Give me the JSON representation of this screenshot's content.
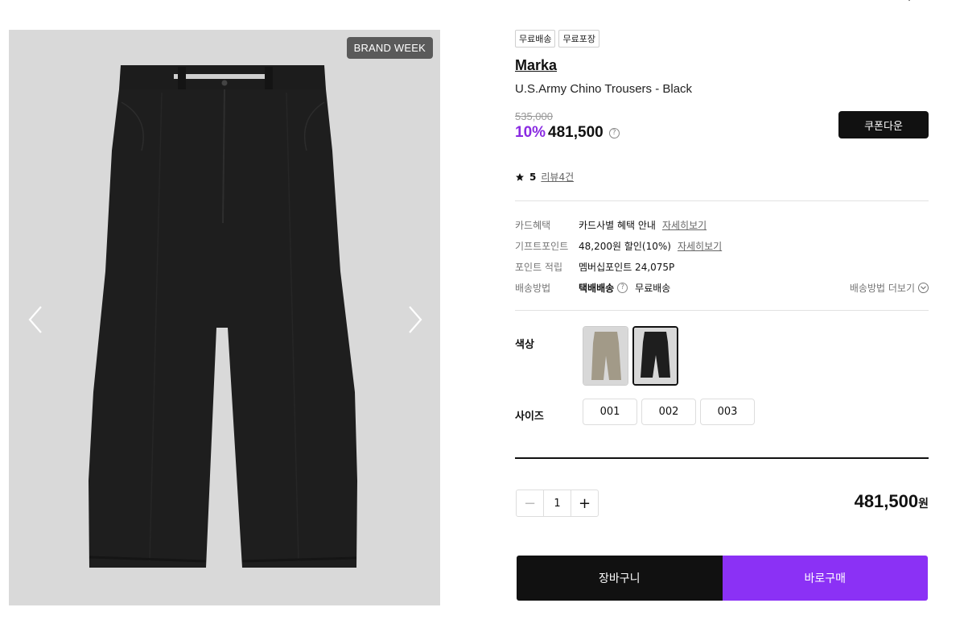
{
  "gallery": {
    "badge": "BRAND WEEK"
  },
  "product": {
    "tags": [
      "무료배송",
      "무료포장"
    ],
    "brand": "Marka",
    "name": "U.S.Army Chino Trousers - Black",
    "original_price": "535,000",
    "discount": "10%",
    "sale_price": "481,500",
    "coupon_button": "쿠폰다운"
  },
  "rating": {
    "score": "5",
    "reviews_link": "리뷰4건"
  },
  "benefits": [
    {
      "label": "카드혜택",
      "value": "카드사별 혜택 안내",
      "link": "자세히보기"
    },
    {
      "label": "기프트포인트",
      "value": "48,200원 할인(10%)",
      "link": "자세히보기"
    },
    {
      "label": "포인트 적립",
      "value": "멤버십포인트 24,075P",
      "link": ""
    },
    {
      "label": "배송방법",
      "value": "택배배송",
      "extra": "무료배송",
      "more": "배송방법 더보기"
    }
  ],
  "options": {
    "color_label": "색상",
    "size_label": "사이즈",
    "sizes": [
      "001",
      "002",
      "003"
    ]
  },
  "purchase": {
    "quantity": "1",
    "total": "481,500",
    "currency": "원",
    "cart_button": "장바구니",
    "buy_button": "바로구매"
  },
  "colors": {
    "accent": "#8b31f5",
    "dark": "#111111"
  }
}
